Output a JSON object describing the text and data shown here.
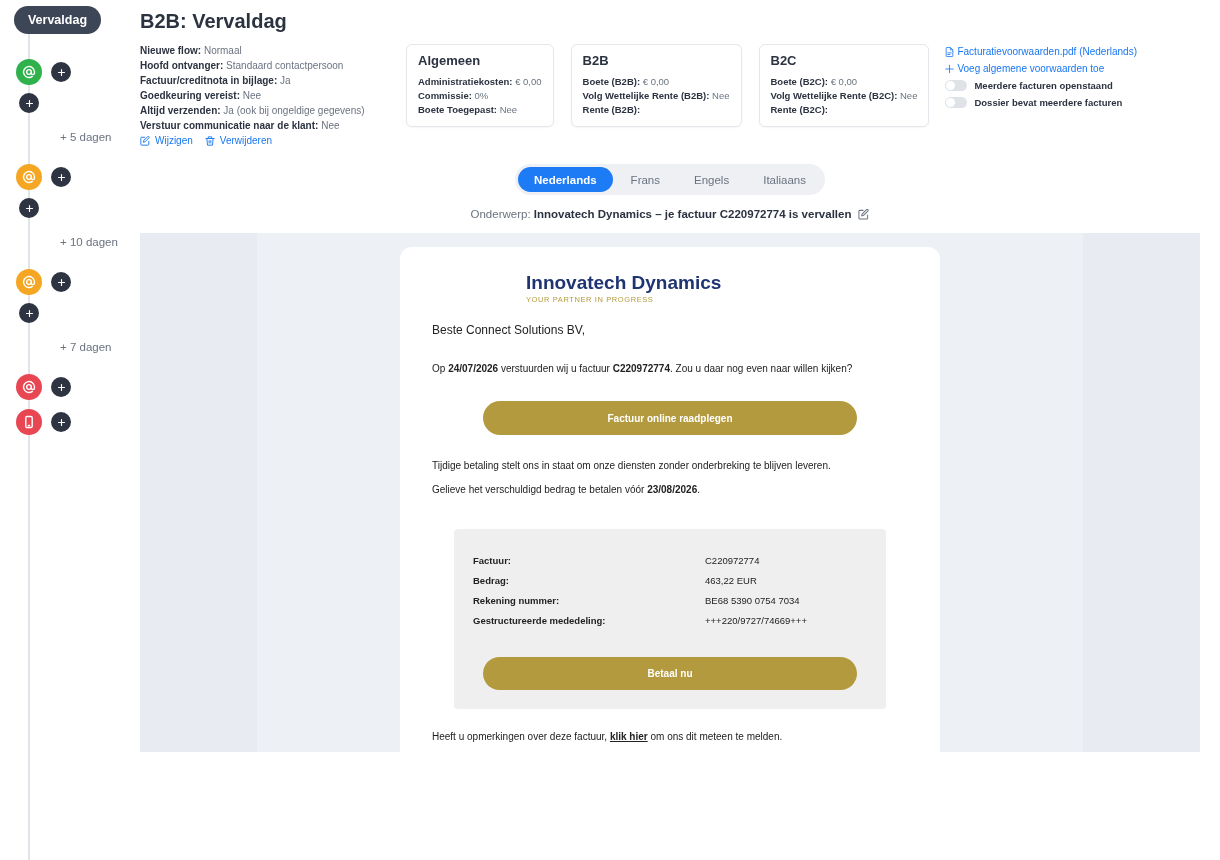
{
  "timeline": {
    "label": "Vervaldag",
    "steps": [
      {
        "kind": "email",
        "color": "#2fb14b",
        "delay": "+ 5 dagen"
      },
      {
        "kind": "email",
        "color": "#f5a623",
        "delay": "+ 10 dagen"
      },
      {
        "kind": "email",
        "color": "#f5a623",
        "delay": "+ 7 dagen"
      },
      {
        "kind": "email",
        "color": "#e94653"
      },
      {
        "kind": "sms",
        "color": "#e94653"
      }
    ]
  },
  "header": {
    "title": "B2B: Vervaldag",
    "properties": [
      {
        "label": "Nieuwe flow:",
        "value": "Normaal"
      },
      {
        "label": "Hoofd ontvanger:",
        "value": "Standaard contactpersoon"
      },
      {
        "label": "Factuur/creditnota in bijlage:",
        "value": "Ja"
      },
      {
        "label": "Goedkeuring vereist:",
        "value": "Nee"
      },
      {
        "label": "Altijd verzenden:",
        "value": "Ja (ook bij ongeldige gegevens)"
      },
      {
        "label": "Verstuur communicatie naar de klant:",
        "value": "Nee"
      }
    ],
    "actions": [
      {
        "kind": "edit",
        "label": "Wijzigen"
      },
      {
        "kind": "delete",
        "label": "Verwijderen"
      }
    ]
  },
  "cards": [
    {
      "title": "Algemeen",
      "rows": [
        {
          "label": "Administratiekosten:",
          "value": "€ 0,00"
        },
        {
          "label": "Commissie:",
          "value": "0%"
        },
        {
          "label": "Boete Toegepast:",
          "value": "Nee"
        }
      ]
    },
    {
      "title": "B2B",
      "rows": [
        {
          "label": "Boete (B2B):",
          "value": "€ 0,00"
        },
        {
          "label": "Volg Wettelijke Rente (B2B):",
          "value": "Nee"
        },
        {
          "label": "Rente (B2B):"
        }
      ]
    },
    {
      "title": "B2C",
      "rows": [
        {
          "label": "Boete (B2C):",
          "value": "€ 0,00"
        },
        {
          "label": "Volg Wettelijke Rente (B2C):",
          "value": "Nee"
        },
        {
          "label": "Rente (B2C):"
        }
      ]
    }
  ],
  "links": [
    {
      "kind": "file",
      "label": "Facturatievoorwaarden.pdf (Nederlands)"
    },
    {
      "kind": "add",
      "label": "Voeg algemene voorwaarden toe"
    }
  ],
  "toggles": [
    {
      "label": "Meerdere facturen openstaand",
      "on": false
    },
    {
      "label": "Dossier bevat meerdere facturen",
      "on": false
    }
  ],
  "language_tabs": [
    {
      "label": "Nederlands",
      "selected": true
    },
    {
      "label": "Frans",
      "selected": false
    },
    {
      "label": "Engels",
      "selected": false
    },
    {
      "label": "Italiaans",
      "selected": false
    }
  ],
  "subject": {
    "label": "Onderwerp:",
    "text": "Innovatech Dynamics – je factuur C220972774 is vervallen"
  },
  "email": {
    "logo": {
      "name": "Innovatech Dynamics",
      "tagline": "YOUR PARTNER IN PROGRESS"
    },
    "greeting": "Beste Connect Solutions BV,",
    "intro": "Op **24/07/2026** verstuurden wij u factuur **C220972774**. Zou u daar nog even naar willen kijken?",
    "view_button": "Factuur online raadplegen",
    "paragraphs": [
      "Tijdige betaling stelt ons in staat om onze diensten zonder onderbreking te blijven leveren.",
      "Gelieve het verschuldigd bedrag te betalen vóór **23/08/2026**."
    ],
    "details": [
      {
        "label": "Factuur:",
        "value": "C220972774"
      },
      {
        "label": "Bedrag:",
        "value": "463,22 EUR"
      },
      {
        "label": "Rekening nummer:",
        "value": "BE68 5390 0754 7034"
      },
      {
        "label": "Gestructureerde mededeling:",
        "value": "+++220/9727/74669+++"
      }
    ],
    "pay_button": "Betaal nu",
    "remark": {
      "before": "Heeft u opmerkingen over deze factuur,",
      "link": "klik hier",
      "after": "om ons dit meteen te melden."
    }
  }
}
